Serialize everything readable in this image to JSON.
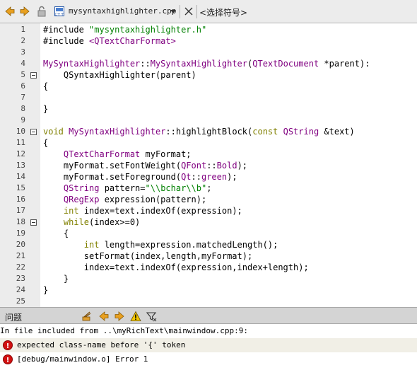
{
  "toolbar": {
    "file_name": "mysyntaxhighlighter.cpp",
    "symbol_selector": "<选择符号>",
    "icons": [
      "back-arrow-icon",
      "forward-arrow-icon",
      "lock-icon",
      "cpp-file-icon",
      "dropdown-arrow-icon",
      "close-icon"
    ]
  },
  "editor": {
    "lines": [
      {
        "n": "1",
        "fold": false,
        "code": "#include \"mysyntaxhighlighter.h\""
      },
      {
        "n": "2",
        "fold": false,
        "code": "#include <QTextCharFormat>"
      },
      {
        "n": "3",
        "fold": false,
        "code": ""
      },
      {
        "n": "4",
        "fold": false,
        "code": "MySyntaxHighlighter::MySyntaxHighlighter(QTextDocument *parent):"
      },
      {
        "n": "5",
        "fold": true,
        "code": "    QSyntaxHighlighter(parent)"
      },
      {
        "n": "6",
        "fold": false,
        "code": "{"
      },
      {
        "n": "7",
        "fold": false,
        "code": ""
      },
      {
        "n": "8",
        "fold": false,
        "code": "}"
      },
      {
        "n": "9",
        "fold": false,
        "code": ""
      },
      {
        "n": "10",
        "fold": true,
        "code": "void MySyntaxHighlighter::highlightBlock(const QString &text)"
      },
      {
        "n": "11",
        "fold": false,
        "code": "{"
      },
      {
        "n": "12",
        "fold": false,
        "code": "    QTextCharFormat myFormat;"
      },
      {
        "n": "13",
        "fold": false,
        "code": "    myFormat.setFontWeight(QFont::Bold);"
      },
      {
        "n": "14",
        "fold": false,
        "code": "    myFormat.setForeground(Qt::green);"
      },
      {
        "n": "15",
        "fold": false,
        "code": "    QString pattern=\"\\\\bchar\\\\b\";"
      },
      {
        "n": "16",
        "fold": false,
        "code": "    QRegExp expression(pattern);"
      },
      {
        "n": "17",
        "fold": false,
        "code": "    int index=text.indexOf(expression);"
      },
      {
        "n": "18",
        "fold": true,
        "code": "    while(index>=0)"
      },
      {
        "n": "19",
        "fold": false,
        "code": "    {"
      },
      {
        "n": "20",
        "fold": false,
        "code": "        int length=expression.matchedLength();"
      },
      {
        "n": "21",
        "fold": false,
        "code": "        setFormat(index,length,myFormat);"
      },
      {
        "n": "22",
        "fold": false,
        "code": "        index=text.indexOf(expression,index+length);"
      },
      {
        "n": "23",
        "fold": false,
        "code": "    }"
      },
      {
        "n": "24",
        "fold": false,
        "code": "}"
      },
      {
        "n": "25",
        "fold": false,
        "code": ""
      }
    ]
  },
  "issues_panel": {
    "title": "问题",
    "items": [
      {
        "type": "info",
        "text": "  In file included from ..\\myRichText\\mainwindow.cpp:9:"
      },
      {
        "type": "error",
        "text": "expected class-name before '{' token"
      },
      {
        "type": "error",
        "text": "[debug/mainwindow.o] Error 1"
      }
    ]
  },
  "colors": {
    "keyword": "#808000",
    "type": "#800080",
    "string": "#008000",
    "error": "#d21010"
  }
}
